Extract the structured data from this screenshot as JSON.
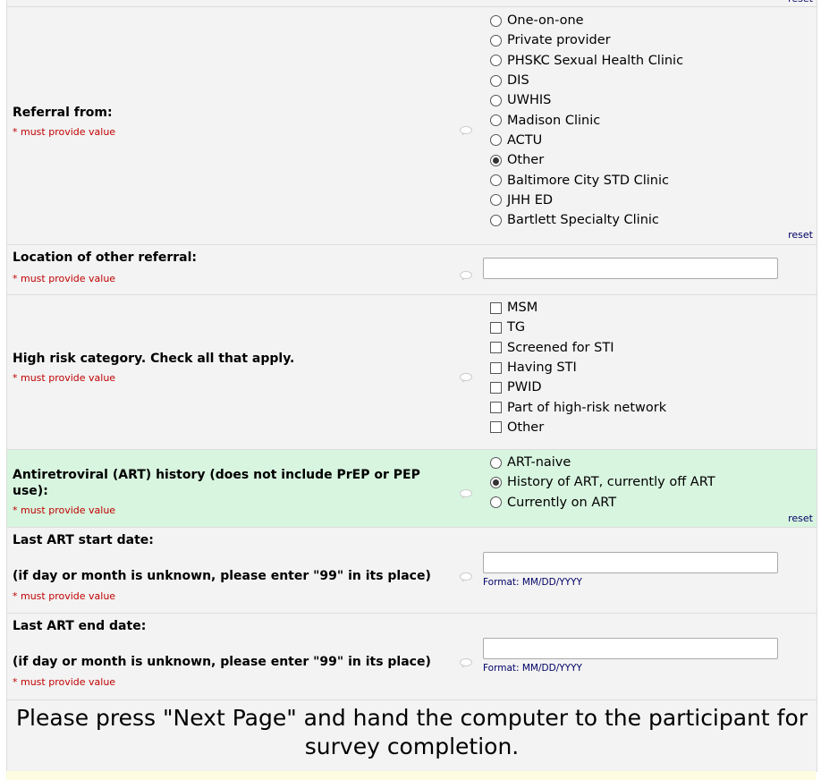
{
  "reset_label": "reset",
  "must_provide": "* must provide value",
  "referral": {
    "label": "Referral from:",
    "options": [
      "One-on-one",
      "Private provider",
      "PHSKC Sexual Health Clinic",
      "DIS",
      "UWHIS",
      "Madison Clinic",
      "ACTU",
      "Other",
      "Baltimore City STD Clinic",
      "JHH ED",
      "Bartlett Specialty Clinic"
    ],
    "selected": "Other"
  },
  "other_location": {
    "label": "Location of other referral:",
    "value": ""
  },
  "high_risk": {
    "label": "High risk category. Check all that apply.",
    "options": [
      "MSM",
      "TG",
      "Screened for STI",
      "Having STI",
      "PWID",
      "Part of high-risk network",
      "Other"
    ]
  },
  "art_history": {
    "label": "Antiretroviral (ART) history (does not include PrEP or PEP use):",
    "options": [
      "ART-naive",
      "History of ART, currently off ART",
      "Currently on ART"
    ],
    "selected": "History of ART, currently off ART"
  },
  "art_start": {
    "label": "Last ART start date:",
    "note": "(if day or month is unknown, please enter \"99\" in its place)",
    "format": "Format: MM/DD/YYYY",
    "value": ""
  },
  "art_end": {
    "label": "Last ART end date:",
    "note": "(if day or month is unknown, please enter \"99\" in its place)",
    "format": "Format: MM/DD/YYYY",
    "value": ""
  },
  "notice": "Please press \"Next Page\" and hand the computer to the participant for survey completion."
}
